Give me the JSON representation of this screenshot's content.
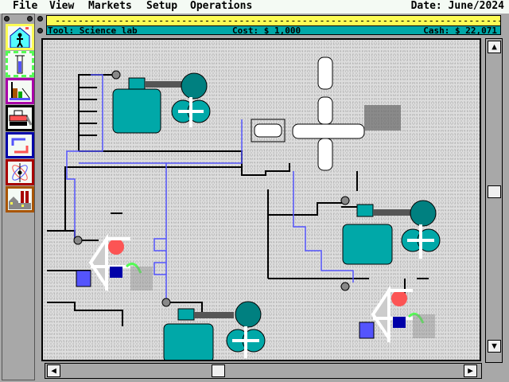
{
  "menu": {
    "items": [
      "File",
      "View",
      "Markets",
      "Setup",
      "Operations"
    ],
    "date": "Date: June/2024"
  },
  "status": {
    "message": "------------------------------------------------------------------------------------------",
    "tool": "Tool: Science lab",
    "cost": "Cost: $ 1,000",
    "cash": "Cash: $ 22,071"
  },
  "toolbox": [
    {
      "icon": "headquarters-icon",
      "border": "#fcfc54"
    },
    {
      "icon": "science-lab-test-tube-icon",
      "border": "#54fc54"
    },
    {
      "icon": "factory-icon",
      "border": "#a800a8"
    },
    {
      "icon": "bulldozer-icon",
      "border": "#000000"
    },
    {
      "icon": "recycle-arrows-icon",
      "border": "#0000a8"
    },
    {
      "icon": "atom-icon",
      "border": "#a80000"
    },
    {
      "icon": "city-icon",
      "border": "#a85400"
    }
  ],
  "colors": {
    "menu_bg": "#f4faf4",
    "message_bar": "#fcfc54",
    "info_bar": "#00a8a8",
    "tank": "#00a8a8",
    "wire": "#5454fc"
  }
}
